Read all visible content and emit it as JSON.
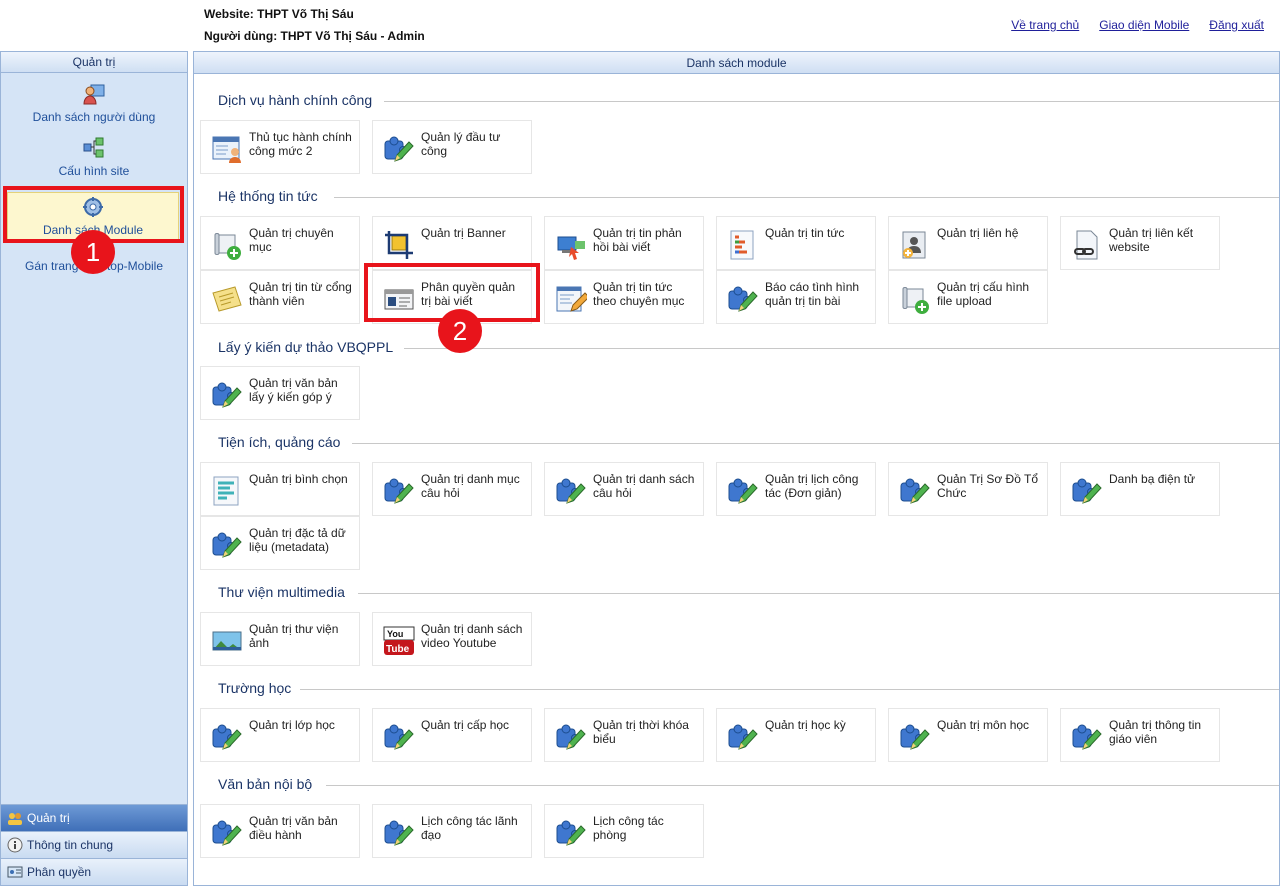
{
  "header": {
    "website_line": "Website: THPT Võ Thị Sáu",
    "user_line": "Người dùng: THPT Võ Thị Sáu - Admin",
    "links": [
      "Về trang chủ",
      "Giao diện Mobile",
      "Đăng xuất"
    ]
  },
  "sidebar": {
    "title": "Quản trị",
    "items": [
      {
        "label": "Danh sách người dùng",
        "icon": "user-list-icon"
      },
      {
        "label": "Cấu hình site",
        "icon": "site-config-icon"
      },
      {
        "label": "Danh sách Module",
        "icon": "module-list-icon"
      },
      {
        "label": "Gán trang Desktop-Mobile"
      }
    ],
    "visible_assign_left": "Gán trang",
    "visible_assign_right": "top-Mobile",
    "bottom": [
      {
        "label": "Quản trị",
        "icon": "admin-icon"
      },
      {
        "label": "Thông tin chung",
        "icon": "info-icon"
      },
      {
        "label": "Phân quyền",
        "icon": "permission-icon"
      }
    ]
  },
  "main": {
    "title": "Danh sách module",
    "groups": [
      {
        "name": "Dịch vụ hành chính công",
        "modules": [
          {
            "label": "Thủ tục hành chính công mức 2",
            "icon": "form-user-icon"
          },
          {
            "label": "Quản lý đầu tư công",
            "icon": "puzzle-edit-icon"
          }
        ]
      },
      {
        "name": "Hệ thống tin tức",
        "modules": [
          {
            "label": "Quản trị chuyên mục",
            "icon": "scroll-add-icon"
          },
          {
            "label": "Quản trị Banner",
            "icon": "crop-icon"
          },
          {
            "label": "Quản trị tin phản hồi bài viết",
            "icon": "feedback-icon"
          },
          {
            "label": "Quản trị tin tức",
            "icon": "news-list-icon"
          },
          {
            "label": "Quản trị liên hệ",
            "icon": "contact-add-icon"
          },
          {
            "label": "Quản trị liên kết website",
            "icon": "link-doc-icon"
          },
          {
            "label": "Quản trị tin từ cổng thành viên",
            "icon": "note-icon"
          },
          {
            "label": "Phân quyền quản trị bài viết",
            "icon": "id-card-icon"
          },
          {
            "label": "Quản trị tin tức theo chuyên mục",
            "icon": "doc-edit-icon"
          },
          {
            "label": "Báo cáo tình hình quản trị tin bài",
            "icon": "puzzle-edit-icon"
          },
          {
            "label": "Quản trị cấu hình file upload",
            "icon": "scroll-add-icon"
          }
        ]
      },
      {
        "name": "Lấy ý kiến dự thảo VBQPPL",
        "modules": [
          {
            "label": "Quản trị văn bản lấy ý kiến góp ý",
            "icon": "puzzle-edit-icon"
          }
        ]
      },
      {
        "name": "Tiện ích, quảng cáo",
        "modules": [
          {
            "label": "Quản trị bình chọn",
            "icon": "poll-icon"
          },
          {
            "label": "Quản trị danh mục câu hỏi",
            "icon": "puzzle-edit-icon"
          },
          {
            "label": "Quản trị danh sách câu hỏi",
            "icon": "puzzle-edit-icon"
          },
          {
            "label": "Quản trị lịch công tác (Đơn giản)",
            "icon": "puzzle-edit-icon"
          },
          {
            "label": "Quản Trị Sơ Đồ Tổ Chức",
            "icon": "puzzle-edit-icon"
          },
          {
            "label": "Danh bạ điện tử",
            "icon": "puzzle-edit-icon"
          },
          {
            "label": "Quản trị đặc tả dữ liệu (metadata)",
            "icon": "puzzle-edit-icon"
          }
        ]
      },
      {
        "name": "Thư viện multimedia",
        "modules": [
          {
            "label": "Quản trị thư viện ảnh",
            "icon": "photo-icon"
          },
          {
            "label": "Quản trị danh sách video Youtube",
            "icon": "youtube-icon"
          }
        ]
      },
      {
        "name": "Trường học",
        "modules": [
          {
            "label": "Quản trị lớp học",
            "icon": "puzzle-edit-icon"
          },
          {
            "label": "Quản trị cấp học",
            "icon": "puzzle-edit-icon"
          },
          {
            "label": "Quản trị thời khóa biểu",
            "icon": "puzzle-edit-icon"
          },
          {
            "label": "Quản trị học kỳ",
            "icon": "puzzle-edit-icon"
          },
          {
            "label": "Quản trị môn học",
            "icon": "puzzle-edit-icon"
          },
          {
            "label": "Quản trị thông tin giáo viên",
            "icon": "puzzle-edit-icon"
          }
        ]
      },
      {
        "name": "Văn bản nội bộ",
        "modules": [
          {
            "label": "Quản trị văn bản điều hành",
            "icon": "puzzle-edit-icon"
          },
          {
            "label": "Lịch công tác lãnh đạo",
            "icon": "puzzle-edit-icon"
          },
          {
            "label": "Lịch công tác phòng",
            "icon": "puzzle-edit-icon"
          }
        ]
      }
    ]
  },
  "annotations": [
    "1",
    "2"
  ],
  "colors": {
    "highlight": "#e8141b",
    "accent": "#1f4f9a",
    "sidebar_bg": "#d5e4f6"
  }
}
